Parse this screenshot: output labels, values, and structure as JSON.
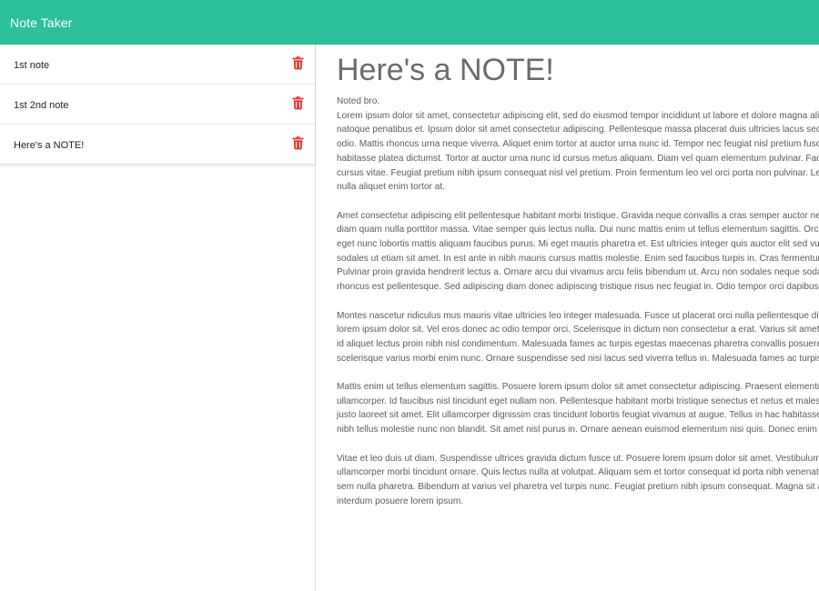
{
  "app": {
    "title": "Note Taker"
  },
  "colors": {
    "navbar": "#2bbf9b",
    "trash": "#e53935"
  },
  "notes": [
    {
      "title": "1st note",
      "icon": "trash-icon"
    },
    {
      "title": "1st 2nd note",
      "icon": "trash-icon"
    },
    {
      "title": "Here's a NOTE!",
      "icon": "trash-icon"
    }
  ],
  "active_note": {
    "title": "Here's a NOTE!",
    "paragraphs": [
      [
        "Noted bro.",
        "Lorem ipsum dolor sit amet, consectetur adipiscing elit, sed do eiusmod tempor incididunt ut labore et dolore magna aliqua.",
        "natoque penatibus et. Ipsum dolor sit amet consectetur adipiscing. Pellentesque massa placerat duis ultricies lacus sed",
        "odio. Mattis rhoncus urna neque viverra. Aliquet enim tortor at auctor urna nunc id. Tempor nec feugiat nisl pretium fusce",
        "habitasse platea dictumst. Tortor at auctor urna nunc id cursus metus aliquam. Diam vel quam elementum pulvinar. Facilisis",
        "cursus vitae. Feugiat pretium nibh ipsum consequat nisl vel pretium. Proin fermentum leo vel orci porta non pulvinar. Leo",
        "nulla aliquet enim tortor at."
      ],
      [
        "Amet consectetur adipiscing elit pellentesque habitant morbi tristique. Gravida neque convallis a cras semper auctor neque",
        "diam quam nulla porttitor massa. Vitae semper quis lectus nulla. Dui nunc mattis enim ut tellus elementum sagittis. Orci",
        "eget nunc lobortis mattis aliquam faucibus purus. Mi eget mauris pharetra et. Est ultricies integer quis auctor elit sed vulputate",
        "sodales ut etiam sit amet. In est ante in nibh mauris cursus mattis molestie. Enim sed faucibus turpis in. Cras fermentum",
        "Pulvinar proin gravida hendrerit lectus a. Ornare arcu dui vivamus arcu felis bibendum ut. Arcu non sodales neque sodales",
        "rhoncus est pellentesque. Sed adipiscing diam donec adipiscing tristique risus nec feugiat in. Odio tempor orci dapibus"
      ],
      [
        "Montes nascetur ridiculus mus mauris vitae ultricies leo integer malesuada. Fusce ut placerat orci nulla pellentesque dignissim",
        "lorem ipsum dolor sit. Vel eros donec ac odio tempor orci. Scelerisque in dictum non consectetur a erat. Varius sit amet",
        "id aliquet lectus proin nibh nisl condimentum. Malesuada fames ac turpis egestas maecenas pharetra convallis posuere",
        "scelerisque varius morbi enim nunc. Ornare suspendisse sed nisi lacus sed viverra tellus in. Malesuada fames ac turpis egestas"
      ],
      [
        "Mattis enim ut tellus elementum sagittis. Posuere lorem ipsum dolor sit amet consectetur adipiscing. Praesent elementum",
        "ullamcorper. Id faucibus nisl tincidunt eget nullam non. Pellentesque habitant morbi tristique senectus et netus et malesuada",
        "justo laoreet sit amet. Elit ullamcorper dignissim cras tincidunt lobortis feugiat vivamus at augue. Tellus in hac habitasse",
        "nibh tellus molestie nunc non blandit. Sit amet nisl purus in. Ornare aenean euismod elementum nisi quis. Donec enim diam"
      ],
      [
        "Vitae et leo duis ut diam. Suspendisse ultrices gravida dictum fusce ut. Posuere lorem ipsum dolor sit amet. Vestibulum",
        "ullamcorper morbi tincidunt ornare. Quis lectus nulla at volutpat. Aliquam sem et tortor consequat id porta nibh venenatis",
        "sem nulla pharetra. Bibendum at varius vel pharetra vel turpis nunc. Feugiat pretium nibh ipsum consequat. Magna sit amet",
        "interdum posuere lorem ipsum."
      ]
    ]
  }
}
